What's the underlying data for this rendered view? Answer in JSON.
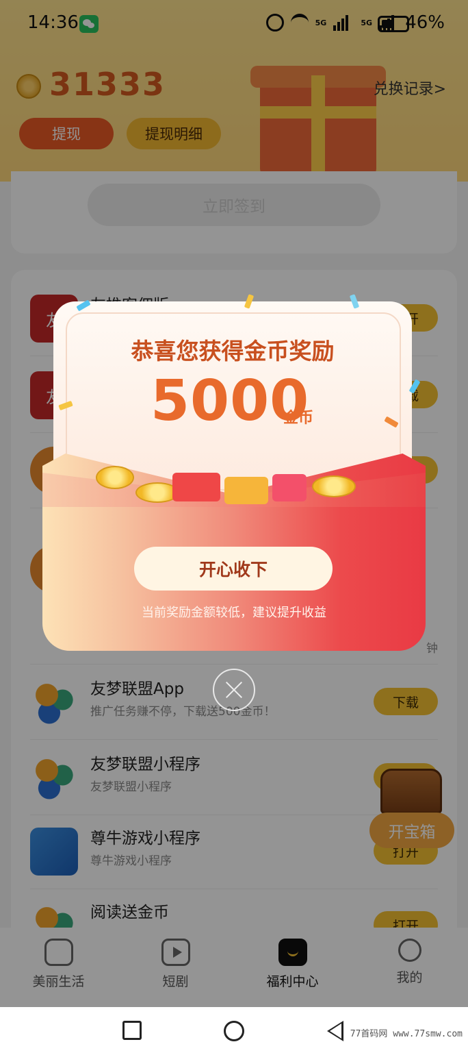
{
  "status_bar": {
    "time": "14:36",
    "network_label_1": "5G",
    "network_label_2": "5G",
    "battery": "46%",
    "icons": [
      "wechat-icon",
      "alarm-icon",
      "wifi-icon",
      "signal-icon",
      "signal-icon",
      "battery-icon"
    ]
  },
  "header": {
    "balance": "31333",
    "exchange_link": "兑换记录>",
    "withdraw_label": "提现",
    "detail_label": "提现明细"
  },
  "signin": {
    "button_label": "立即签到"
  },
  "tasks": [
    {
      "title": "友推客佣版",
      "subtitle": "",
      "button": "打开",
      "logo_text": "友",
      "logo": "red"
    },
    {
      "title": "",
      "subtitle": "",
      "button": "下载",
      "logo_text": "友",
      "logo": "red"
    },
    {
      "title": "",
      "subtitle": "",
      "button": "打开",
      "logo_text": "",
      "logo": "orange"
    },
    {
      "title": "",
      "subtitle": "",
      "button": "",
      "logo_text": "",
      "logo": "orange",
      "trailing_text": "钟"
    },
    {
      "title": "友梦联盟App",
      "subtitle": "推广任务赚不停，下载送500金币！",
      "button": "下载",
      "logo_text": "",
      "logo": "ym"
    },
    {
      "title": "友梦联盟小程序",
      "subtitle": "友梦联盟小程序",
      "button": "打开",
      "logo_text": "",
      "logo": "ym"
    },
    {
      "title": "尊牛游戏小程序",
      "subtitle": "尊牛游戏小程序",
      "button": "打开",
      "logo_text": "",
      "logo": "zn"
    },
    {
      "title": "阅读送金币",
      "subtitle": "",
      "button": "打开",
      "logo_text": "",
      "logo": "ym"
    }
  ],
  "treasure": {
    "label": "开宝箱"
  },
  "modal": {
    "title": "恭喜您获得金币奖励",
    "amount": "5000",
    "unit": "金币",
    "collect_label": "开心收下",
    "tip": "当前奖励金额较低，建议提升收益"
  },
  "bottom_nav": [
    {
      "label": "美丽生活",
      "icon": "home-icon",
      "active": false
    },
    {
      "label": "短剧",
      "icon": "play-icon",
      "active": false
    },
    {
      "label": "福利中心",
      "icon": "welfare-icon",
      "active": true
    },
    {
      "label": "我的",
      "icon": "user-icon",
      "active": false
    }
  ],
  "watermark": "77首码网 www.77smw.com",
  "colors": {
    "accent_orange": "#ea5a25",
    "accent_yellow": "#f4c232",
    "reward_red": "#e93a44",
    "amount_orange": "#e86a2c"
  }
}
